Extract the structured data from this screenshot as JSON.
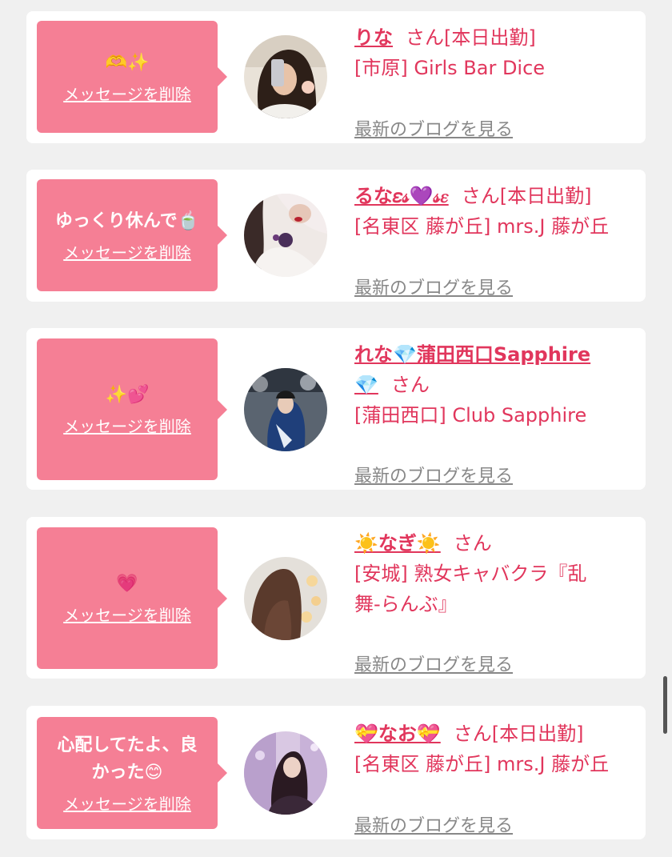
{
  "cards": [
    {
      "message": "🫶✨",
      "delete_label": "メッセージを削除",
      "name": "りな",
      "san": "さん",
      "status": "[本日出勤]",
      "shop": "[市原] Girls Bar Dice",
      "blog": "最新のブログを見る"
    },
    {
      "message": "ゆっくり休んで🍵",
      "delete_label": "メッセージを削除",
      "name": "るな𝜀𝓈💜𝓈𝜀",
      "san": "さん",
      "status": "[本日出勤]",
      "shop": "[名東区 藤が丘] mrs.J 藤が丘",
      "blog": "最新のブログを見る"
    },
    {
      "message": "✨💕",
      "delete_label": "メッセージを削除",
      "name_line1": "れな💎蒲田西口Sapphire",
      "name_line2": "💎",
      "san": "さん",
      "shop": "[蒲田西口] Club Sapphire",
      "blog": "最新のブログを見る"
    },
    {
      "message": "💗",
      "delete_label": "メッセージを削除",
      "name": "☀️なぎ☀️",
      "san": "さん",
      "shop_line1": "[安城] 熟女キャバクラ『乱",
      "shop_line2": "舞-らんぶ』",
      "blog": "最新のブログを見る"
    },
    {
      "message_line1": "心配してたよ、良",
      "message_line2": "かった😊",
      "delete_label": "メッセージを削除",
      "name": "💝なお💝",
      "san": "さん",
      "status": "[本日出勤]",
      "shop": "[名東区 藤が丘] mrs.J 藤が丘",
      "blog": "最新のブログを見る"
    }
  ],
  "colors": {
    "accent": "#e1365c",
    "bubble": "#f57f95",
    "background": "#f0f0f0"
  }
}
